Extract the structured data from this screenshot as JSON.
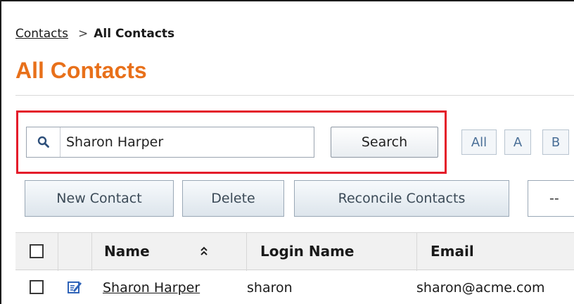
{
  "breadcrumb": {
    "parent": "Contacts",
    "separator": ">",
    "current": "All Contacts"
  },
  "page": {
    "title": "All Contacts"
  },
  "search": {
    "value": "Sharon Harper",
    "button_label": "Search",
    "icon": "search-icon"
  },
  "alphabet_filter": [
    "All",
    "A",
    "B"
  ],
  "toolbar": {
    "new_contact": "New Contact",
    "delete": "Delete",
    "reconcile": "Reconcile Contacts",
    "select_partial": "--"
  },
  "table": {
    "columns": [
      "Name",
      "Login Name",
      "Email"
    ],
    "sort_icon": "sort-icon",
    "rows": [
      {
        "name": "Sharon Harper",
        "login": "sharon",
        "email": "sharon@acme.com"
      }
    ]
  },
  "colors": {
    "title": "#e8701a",
    "highlight": "#e41c2a",
    "link_blue": "#4a6f97"
  }
}
